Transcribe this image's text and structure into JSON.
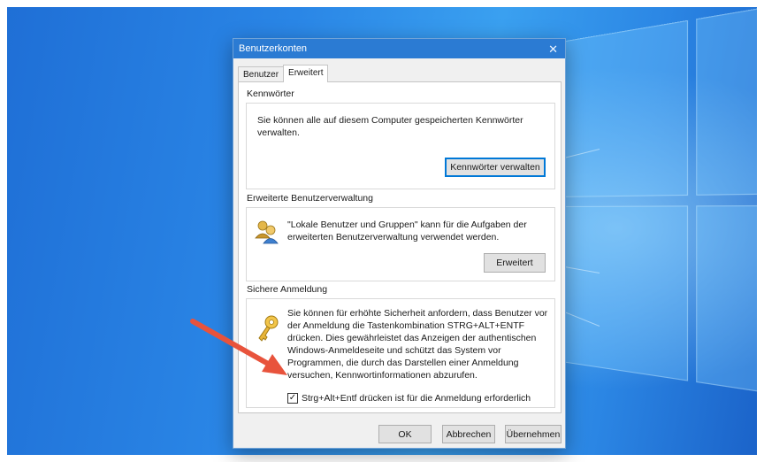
{
  "dialog": {
    "title": "Benutzerkonten",
    "tabs": [
      {
        "label": "Benutzer",
        "active": false
      },
      {
        "label": "Erweitert",
        "active": true
      }
    ]
  },
  "passwords": {
    "title": "Kennwörter",
    "text": "Sie können alle auf diesem Computer gespeicherten Kennwörter verwalten.",
    "button_label": "Kennwörter verwalten"
  },
  "advanced": {
    "title": "Erweiterte Benutzerverwaltung",
    "text": "\"Lokale Benutzer und Gruppen\" kann für die Aufgaben der erweiterten Benutzerverwaltung verwendet werden.",
    "button_label": "Erweitert"
  },
  "secure_logon": {
    "title": "Sichere Anmeldung",
    "text": "Sie können für erhöhte Sicherheit anfordern, dass Benutzer vor der Anmeldung die Tastenkombination STRG+ALT+ENTF drücken. Dies gewährleistet das Anzeigen der authentischen Windows-Anmeldeseite und schützt das System vor Programmen, die durch das Darstellen einer Anmeldung versuchen, Kennwortinformationen abzurufen.",
    "checkbox_label": "Strg+Alt+Entf drücken ist für die Anmeldung erforderlich",
    "checkbox_checked": true
  },
  "footer": {
    "ok_label": "OK",
    "cancel_label": "Abbrechen",
    "apply_label": "Übernehmen"
  },
  "colors": {
    "titlebar": "#2b7bd3",
    "annotation_arrow": "#e8533c"
  }
}
